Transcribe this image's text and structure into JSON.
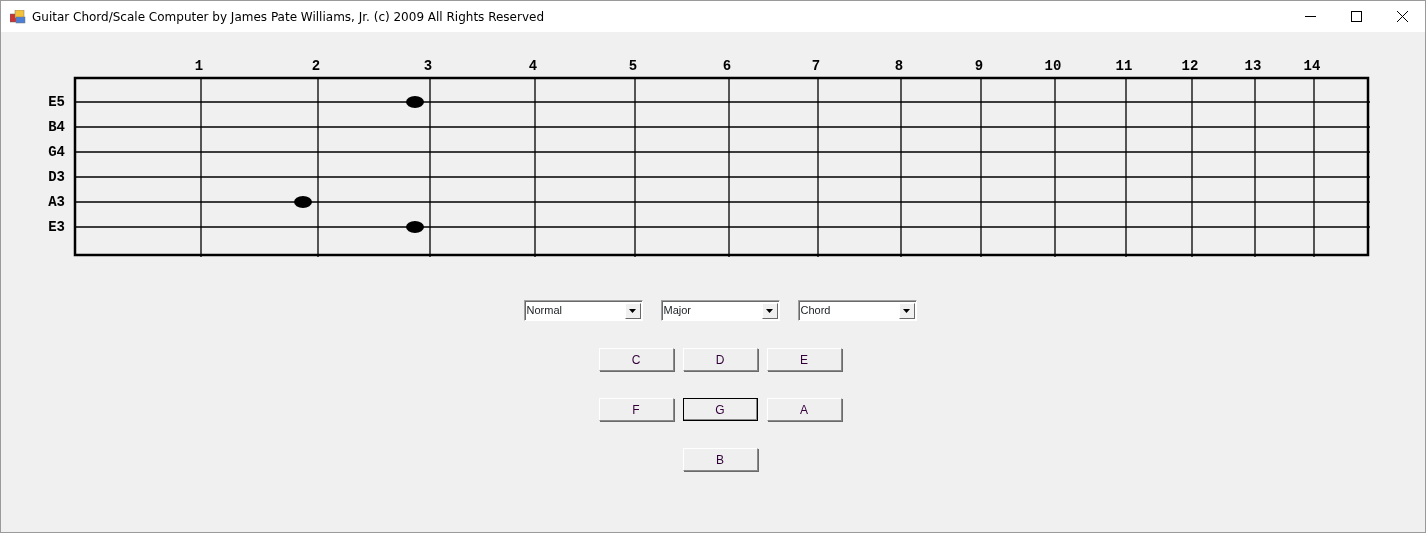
{
  "window": {
    "title": "Guitar Chord/Scale Computer by James Pate Williams, Jr. (c) 2009 All Rights Reserved"
  },
  "fret_numbers": [
    "1",
    "2",
    "3",
    "4",
    "5",
    "6",
    "7",
    "8",
    "9",
    "10",
    "11",
    "12",
    "13",
    "14"
  ],
  "strings": [
    {
      "label": "E5",
      "dots": [
        false,
        false,
        true,
        false,
        false,
        false,
        false,
        false,
        false,
        false,
        false,
        false,
        false,
        false
      ]
    },
    {
      "label": "B4",
      "dots": [
        false,
        false,
        false,
        false,
        false,
        false,
        false,
        false,
        false,
        false,
        false,
        false,
        false,
        false
      ]
    },
    {
      "label": "G4",
      "dots": [
        false,
        false,
        false,
        false,
        false,
        false,
        false,
        false,
        false,
        false,
        false,
        false,
        false,
        false
      ]
    },
    {
      "label": "D3",
      "dots": [
        false,
        false,
        false,
        false,
        false,
        false,
        false,
        false,
        false,
        false,
        false,
        false,
        false,
        false
      ]
    },
    {
      "label": "A3",
      "dots": [
        false,
        true,
        false,
        false,
        false,
        false,
        false,
        false,
        false,
        false,
        false,
        false,
        false,
        false
      ]
    },
    {
      "label": "E3",
      "dots": [
        false,
        false,
        true,
        false,
        false,
        false,
        false,
        false,
        false,
        false,
        false,
        false,
        false,
        false
      ]
    }
  ],
  "dropdowns": [
    {
      "value": "Normal"
    },
    {
      "value": "Major"
    },
    {
      "value": "Chord"
    }
  ],
  "note_buttons": [
    {
      "label": "C",
      "selected": false
    },
    {
      "label": "D",
      "selected": false
    },
    {
      "label": "E",
      "selected": false
    },
    {
      "label": "F",
      "selected": false
    },
    {
      "label": "G",
      "selected": true
    },
    {
      "label": "A",
      "selected": false
    },
    {
      "label": "B",
      "selected": false
    }
  ]
}
